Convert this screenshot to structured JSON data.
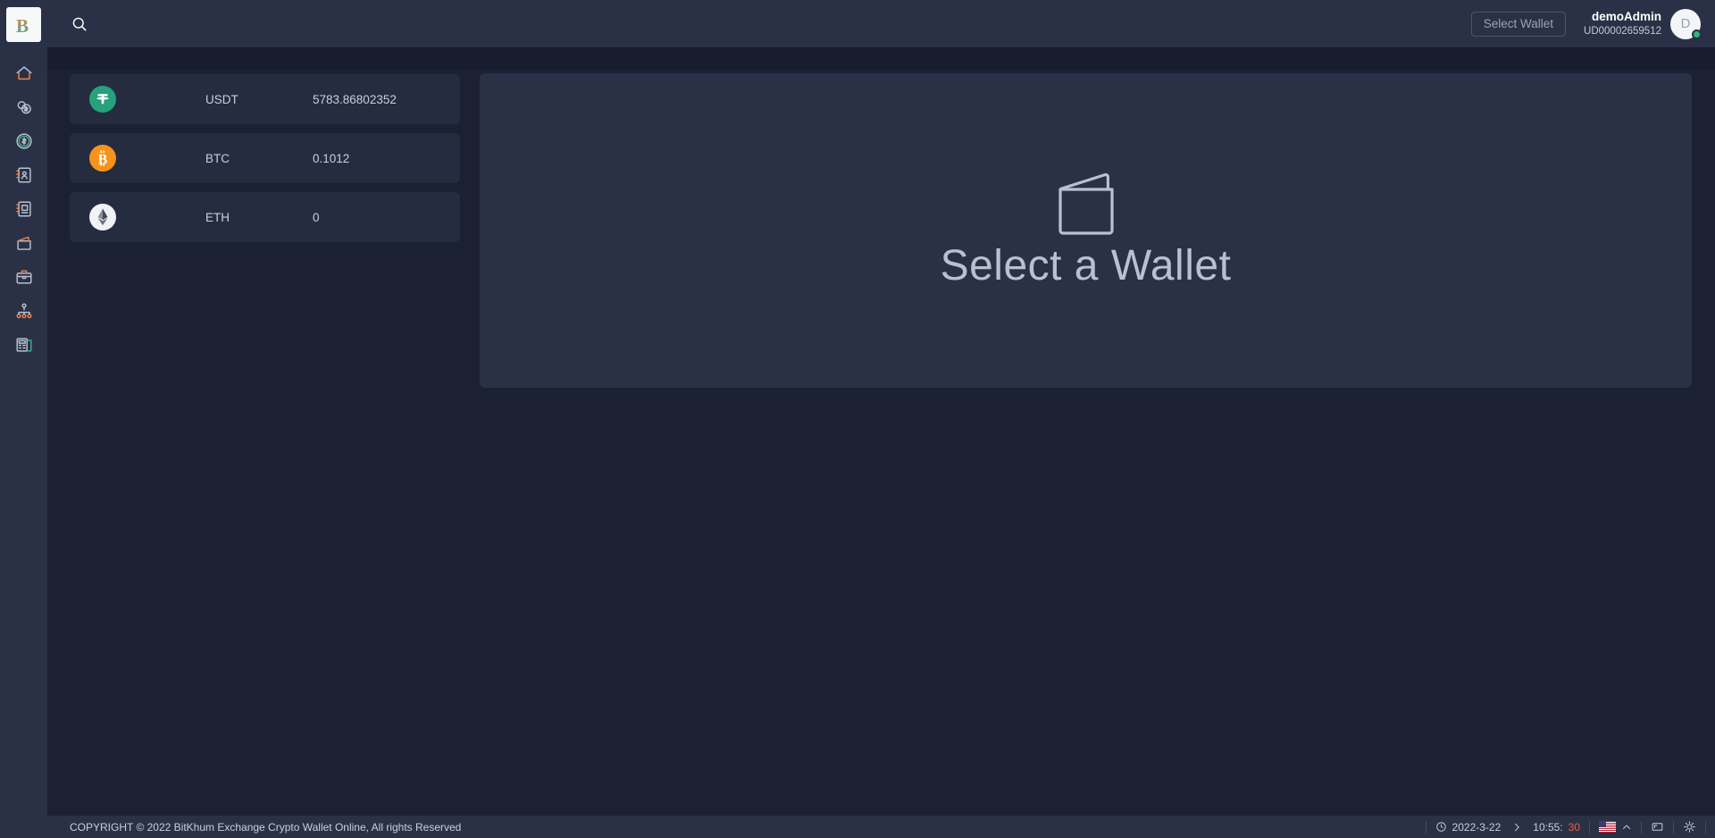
{
  "app": {
    "logo_letter": "B",
    "background_color": "#1b2132",
    "panel_color": "#2a3147",
    "accent_orange": "#e8854a",
    "accent_teal": "#3fae8e",
    "accent_red": "#e8603c"
  },
  "sidebar": {
    "items": [
      {
        "icon": "home-icon",
        "label": "Home"
      },
      {
        "icon": "coins-icon",
        "label": "Coins"
      },
      {
        "icon": "coin-dollar-icon",
        "label": "Currency"
      },
      {
        "icon": "contact-book-icon",
        "label": "Contacts"
      },
      {
        "icon": "notebook-icon",
        "label": "Ledger"
      },
      {
        "icon": "wallet-icon",
        "label": "Wallet"
      },
      {
        "icon": "briefcase-icon",
        "label": "Portfolio"
      },
      {
        "icon": "sitemap-icon",
        "label": "Organization"
      },
      {
        "icon": "report-icon",
        "label": "Reports"
      }
    ]
  },
  "header": {
    "search_icon": "search-icon",
    "select_wallet_label": "Select Wallet",
    "user_name": "demoAdmin",
    "user_id": "UD00002659512",
    "avatar_letter": "D",
    "status": "online"
  },
  "wallets": {
    "rows": [
      {
        "icon": "usdt-icon",
        "symbol": "USDT",
        "balance": "5783.86802352"
      },
      {
        "icon": "btc-icon",
        "symbol": "BTC",
        "balance": "0.1012"
      },
      {
        "icon": "eth-icon",
        "symbol": "ETH",
        "balance": "0"
      }
    ]
  },
  "main": {
    "empty_icon": "wallet-outline-icon",
    "empty_title": "Select a Wallet"
  },
  "footer": {
    "copyright": "COPYRIGHT © 2022 BitKhum Exchange Crypto Wallet Online, All rights Reserved",
    "clock_icon": "clock-icon",
    "date": "2022-3-22",
    "separator_icon": "chevron-right-icon",
    "time_hm": "10:55:",
    "time_seconds": "30",
    "language_icon": "us-flag-icon",
    "language_chevron": "chevron-up-icon",
    "fullscreen_icon": "fullscreen-icon",
    "brightness_icon": "sun-icon"
  }
}
